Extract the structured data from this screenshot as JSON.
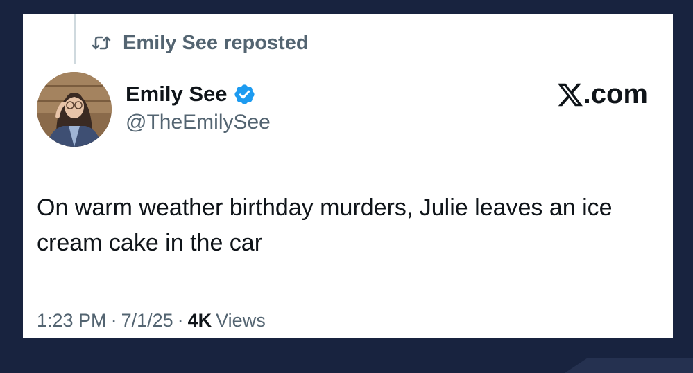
{
  "post": {
    "repost_label": "Emily See reposted",
    "author": {
      "display_name": "Emily See",
      "handle": "@TheEmilySee",
      "verified": true
    },
    "brand": {
      "text": ".com",
      "icon": "x-logo-icon"
    },
    "body": "On warm weather birthday murders, Julie leaves an ice cream cake in the car",
    "meta": {
      "time": "1:23 PM",
      "separator": "·",
      "date": "7/1/25",
      "views_count": "4K",
      "views_label": "Views"
    }
  },
  "colors": {
    "background": "#18233f",
    "card": "#ffffff",
    "secondary_text": "#536471",
    "primary_text": "#0f1419",
    "verified_blue": "#1d9bf0"
  }
}
